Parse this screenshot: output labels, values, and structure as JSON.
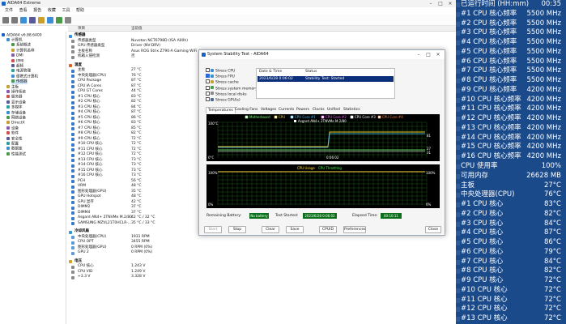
{
  "app": {
    "window_title": "AIDA64 Extreme",
    "menus": [
      "文件",
      "查看",
      "报告",
      "收藏",
      "工具",
      "帮助"
    ],
    "tree_root": "AIDA64 v6.88.6400",
    "tree_items": [
      "计算机",
      "系统概述",
      "计算机名称",
      "DMI",
      "IPMI",
      "超频",
      "电源管理",
      "便携式计算机",
      "传感器",
      "主板",
      "操作系统",
      "服务器",
      "显示设备",
      "多媒体",
      "存储设备",
      "网络设备",
      "DirectX",
      "设备",
      "软件",
      "安全性",
      "配置",
      "数据库",
      "性能测试"
    ],
    "columns": {
      "item": "项目",
      "value": "当前值"
    }
  },
  "sensors": {
    "groups": [
      {
        "title": "传感器",
        "rows": [
          {
            "label": "传感器类型",
            "value": "Nuvoton NCT6798D (ISA A00h)"
          },
          {
            "label": "GPU 传感器类型",
            "value": "Driver (NV-DRV)"
          },
          {
            "label": "主板名称",
            "value": "Asus ROG Strix Z790-A Gaming WiFi"
          },
          {
            "label": "机箱入侵检测",
            "value": "否"
          }
        ]
      },
      {
        "title": "温度",
        "rows": [
          {
            "label": "主板",
            "value": "27 °C"
          },
          {
            "label": "中央处理器(CPU)",
            "value": "76 °C"
          },
          {
            "label": "CPU Package",
            "value": "87 °C"
          },
          {
            "label": "CPU IA Cores",
            "value": "87 °C"
          },
          {
            "label": "CPU GT Cores",
            "value": "44 °C"
          },
          {
            "label": "#1 CPU 核心",
            "value": "83 °C"
          },
          {
            "label": "#2 CPU 核心",
            "value": "82 °C"
          },
          {
            "label": "#3 CPU 核心",
            "value": "84 °C"
          },
          {
            "label": "#4 CPU 核心",
            "value": "87 °C"
          },
          {
            "label": "#5 CPU 核心",
            "value": "86 °C"
          },
          {
            "label": "#6 CPU 核心",
            "value": "83 °C"
          },
          {
            "label": "#7 CPU 核心",
            "value": "85 °C"
          },
          {
            "label": "#8 CPU 核心",
            "value": "82 °C"
          },
          {
            "label": "#9 CPU 核心",
            "value": "72 °C"
          },
          {
            "label": "#10 CPU 核心",
            "value": "72 °C"
          },
          {
            "label": "#11 CPU 核心",
            "value": "72 °C"
          },
          {
            "label": "#12 CPU 核心",
            "value": "72 °C"
          },
          {
            "label": "#13 CPU 核心",
            "value": "73 °C"
          },
          {
            "label": "#14 CPU 核心",
            "value": "73 °C"
          },
          {
            "label": "#15 CPU 核心",
            "value": "73 °C"
          },
          {
            "label": "#16 CPU 核心",
            "value": "73 °C"
          },
          {
            "label": "PCH",
            "value": "56 °C"
          },
          {
            "label": "VRM",
            "value": "48 °C"
          },
          {
            "label": "图形处理器(GPU)",
            "value": "35 °C"
          },
          {
            "label": "GPU Hotspot",
            "value": "48 °C"
          },
          {
            "label": "GPU 显存",
            "value": "42 °C"
          },
          {
            "label": "DIMM2",
            "value": "37 °C"
          },
          {
            "label": "DIMM4",
            "value": "37 °C"
          },
          {
            "label": "Asgard AN4+ 2TNVMe M.2/80",
            "value": "42 °C / 32 °C"
          },
          {
            "label": "SAMSUNG MZVL21T0HCLR-...",
            "value": "35 °C / 33 °C"
          }
        ]
      },
      {
        "title": "冷却风扇",
        "rows": [
          {
            "label": "中央处理器(CPU)",
            "value": "1931 RPM"
          },
          {
            "label": "CPU OPT",
            "value": "3455 RPM"
          },
          {
            "label": "图形处理器(GPU)",
            "value": "0 RPM (0%)"
          },
          {
            "label": "GPU 2",
            "value": "0 RPM (0%)"
          }
        ]
      },
      {
        "title": "电压",
        "rows": [
          {
            "label": "CPU 核心",
            "value": "1.243 V"
          },
          {
            "label": "CPU VID",
            "value": "1.249 V"
          },
          {
            "label": "+3.3 V",
            "value": "3.328 V"
          }
        ]
      }
    ]
  },
  "dialog": {
    "title": "System Stability Test - AIDA64",
    "checks": [
      {
        "label": "Stress CPU",
        "on": false
      },
      {
        "label": "Stress FPU",
        "on": true
      },
      {
        "label": "Stress cache",
        "on": false
      },
      {
        "label": "Stress system memory",
        "on": false
      },
      {
        "label": "Stress local disks",
        "on": false
      },
      {
        "label": "Stress GPU(s)",
        "on": false
      }
    ],
    "status_headers": {
      "date": "Date & Time",
      "status": "Status"
    },
    "status_row": {
      "date": "2023/6/28 0:06:02",
      "status": "Stability Test: Started"
    },
    "tabs": [
      "Temperatures",
      "Cooling Fans",
      "Voltages",
      "Currents",
      "Powers",
      "Clocks",
      "Unified",
      "Statistics"
    ],
    "legend": [
      "Motherboard",
      "CPU",
      "CPU Core #1",
      "CPU Core #2",
      "CPU Core #3",
      "CPU Core #4"
    ],
    "legend2": "Asgard AN4+ 2TNVMe M.2/80",
    "graph1": {
      "ymax": "100°C",
      "ymin": "0°C",
      "time": "0:06:02",
      "values": [
        "81",
        "27",
        "31"
      ]
    },
    "graph2": {
      "title_usage": "CPU Usage",
      "title_throttle": "CPU Throttling",
      "ymax": "100%",
      "ymin": "0%",
      "right_top": "100%",
      "right_bottom": "0%"
    },
    "info": {
      "battery_label": "Remaining Battery:",
      "battery": "No battery",
      "started_label": "Test Started:",
      "started": "2023/6/28 0:06:02",
      "elapsed_label": "Elapsed Time:",
      "elapsed": "00:10:11"
    },
    "buttons": [
      "Start",
      "Stop",
      "Clear",
      "Save",
      "CPUID",
      "Preferences",
      "Close"
    ]
  },
  "osd": {
    "rows": [
      {
        "label": "已运行时间 (HH:mm)",
        "value": "00:35"
      },
      {
        "label": "#1 CPU 核心频率",
        "value": "5500 MHz"
      },
      {
        "label": "#2 CPU 核心频率",
        "value": "5500 MHz"
      },
      {
        "label": "#3 CPU 核心频率",
        "value": "5500 MHz"
      },
      {
        "label": "#4 CPU 核心频率",
        "value": "5500 MHz"
      },
      {
        "label": "#5 CPU 核心频率",
        "value": "5500 MHz"
      },
      {
        "label": "#6 CPU 核心频率",
        "value": "5500 MHz"
      },
      {
        "label": "#7 CPU 核心频率",
        "value": "5500 MHz"
      },
      {
        "label": "#8 CPU 核心频率",
        "value": "5500 MHz"
      },
      {
        "label": "#9 CPU 核心频率",
        "value": "4200 MHz"
      },
      {
        "label": "#10 CPU 核心频率",
        "value": "4200 MHz"
      },
      {
        "label": "#11 CPU 核心频率",
        "value": "4200 MHz"
      },
      {
        "label": "#12 CPU 核心频率",
        "value": "4200 MHz"
      },
      {
        "label": "#13 CPU 核心频率",
        "value": "4200 MHz"
      },
      {
        "label": "#14 CPU 核心频率",
        "value": "4200 MHz"
      },
      {
        "label": "#15 CPU 核心频率",
        "value": "4200 MHz"
      },
      {
        "label": "#16 CPU 核心频率",
        "value": "4200 MHz"
      },
      {
        "label": "CPU 使用率",
        "value": "100%"
      },
      {
        "label": "可用内存",
        "value": "26628 MB"
      },
      {
        "label": "主板",
        "value": "27°C"
      },
      {
        "label": "中央处理器(CPU)",
        "value": "76°C"
      },
      {
        "label": "#1 CPU 核心",
        "value": "83°C"
      },
      {
        "label": "#2 CPU 核心",
        "value": "82°C"
      },
      {
        "label": "#3 CPU 核心",
        "value": "84°C"
      },
      {
        "label": "#4 CPU 核心",
        "value": "87°C"
      },
      {
        "label": "#5 CPU 核心",
        "value": "86°C"
      },
      {
        "label": "#6 CPU 核心",
        "value": "79°C"
      },
      {
        "label": "#7 CPU 核心",
        "value": "84°C"
      },
      {
        "label": "#8 CPU 核心",
        "value": "82°C"
      },
      {
        "label": "#9 CPU 核心",
        "value": "72°C"
      },
      {
        "label": "#10 CPU 核心",
        "value": "72°C"
      },
      {
        "label": "#11 CPU 核心",
        "value": "72°C"
      },
      {
        "label": "#12 CPU 核心",
        "value": "72°C"
      },
      {
        "label": "#13 CPU 核心",
        "value": "72°C"
      }
    ]
  },
  "colors": {
    "osd_bg": "#1a4a8a",
    "osd_text": "#ffffff",
    "graph_grid": "#1f6a1f",
    "status_blue": "#0b2f7a",
    "status_green": "#0b6f1a"
  }
}
